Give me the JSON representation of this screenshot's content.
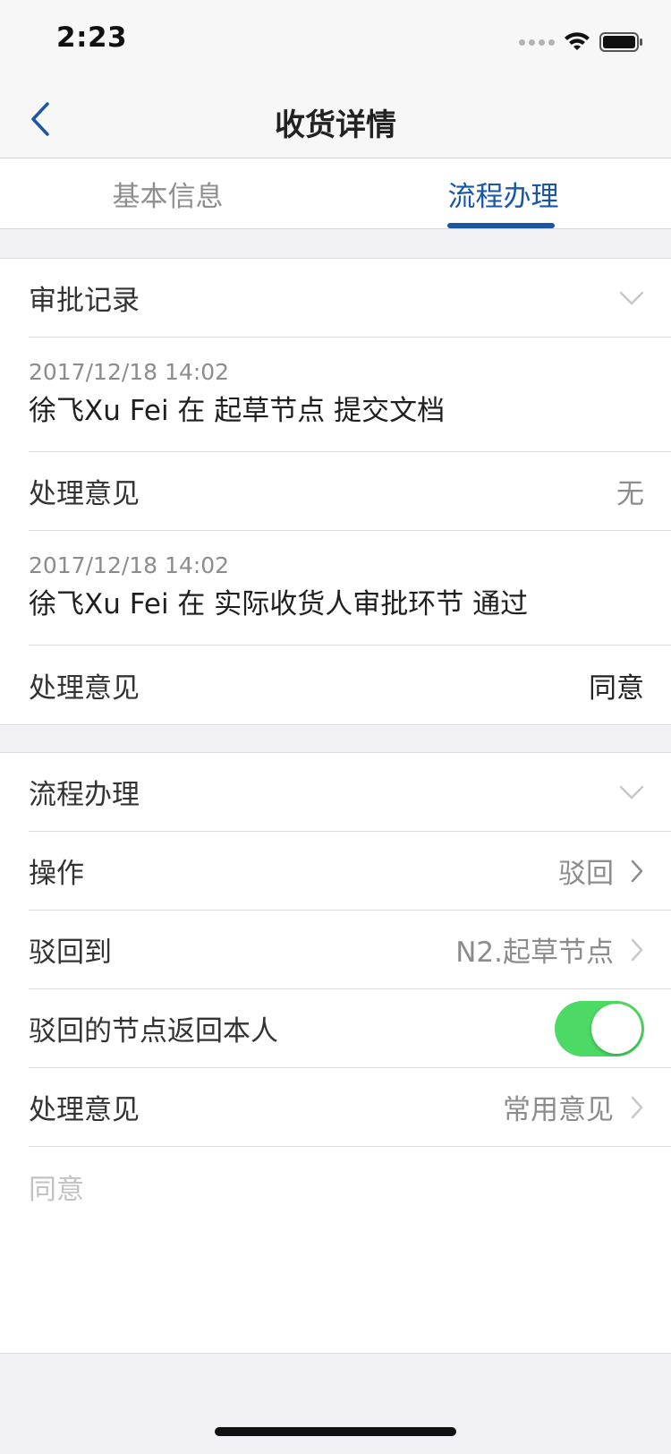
{
  "status_bar": {
    "time": "2:23"
  },
  "navbar": {
    "title": "收货详情"
  },
  "tabs": [
    {
      "label": "基本信息",
      "active": false
    },
    {
      "label": "流程办理",
      "active": true
    }
  ],
  "approval_section": {
    "title": "审批记录",
    "records": [
      {
        "time": "2017/12/18 14:02",
        "text": "徐飞Xu Fei 在 起草节点 提交文档",
        "opinion_label": "处理意见",
        "opinion_value": "无"
      },
      {
        "time": "2017/12/18 14:02",
        "text": "徐飞Xu Fei 在 实际收货人审批环节 通过",
        "opinion_label": "处理意见",
        "opinion_value": "同意"
      }
    ]
  },
  "process_section": {
    "title": "流程办理",
    "operation": {
      "label": "操作",
      "value": "驳回"
    },
    "reject_to": {
      "label": "驳回到",
      "value": "N2.起草节点"
    },
    "return_to_self": {
      "label": "驳回的节点返回本人",
      "enabled": true
    },
    "opinion": {
      "label": "处理意见",
      "value": "常用意见"
    },
    "opinion_input": {
      "placeholder": "同意"
    }
  },
  "colors": {
    "accent": "#1a56a8",
    "toggle_on": "#4cd964",
    "background": "#f2f2f6"
  }
}
